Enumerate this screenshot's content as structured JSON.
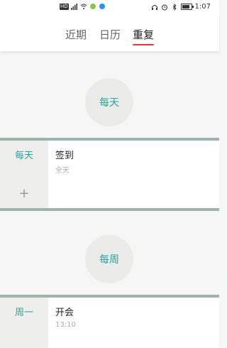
{
  "status_bar": {
    "hd_label": "HD",
    "time": "1:07"
  },
  "tabs": [
    {
      "label": "近期",
      "active": false
    },
    {
      "label": "日历",
      "active": false
    },
    {
      "label": "重复",
      "active": true
    }
  ],
  "sections": [
    {
      "badge": "每天",
      "side_label": "每天",
      "add_glyph": "+",
      "event": {
        "title": "签到",
        "subtitle": "全天"
      }
    },
    {
      "badge": "每周",
      "side_label": "周一",
      "event": {
        "title": "开会",
        "subtitle": "13:10"
      }
    }
  ],
  "colors": {
    "accent": "#26a69a",
    "tab_indicator": "#e53935",
    "divider": "#9eb2ae"
  }
}
